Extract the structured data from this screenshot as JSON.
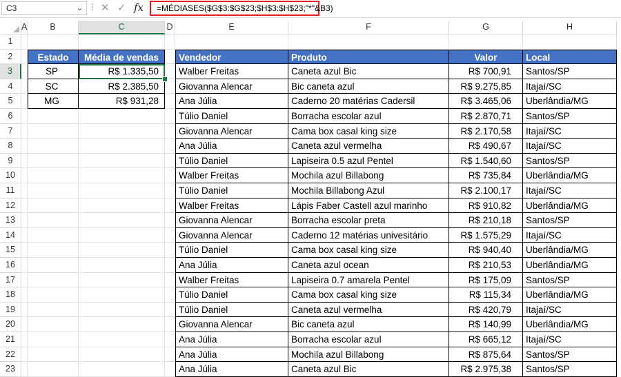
{
  "formula_bar": {
    "name_box": "C3",
    "formula": "=MÉDIASES($G$3:$G$23;$H$3:$H$23;\"*\"&B3)",
    "fx_label": "fx"
  },
  "columns": [
    "A",
    "B",
    "C",
    "D",
    "E",
    "F",
    "G",
    "H"
  ],
  "rows": [
    "1",
    "2",
    "3",
    "4",
    "5",
    "6",
    "7",
    "8",
    "9",
    "10",
    "11",
    "12",
    "13",
    "14",
    "15",
    "16",
    "17",
    "18",
    "19",
    "20",
    "21",
    "22",
    "23"
  ],
  "summary": {
    "headers": [
      "Estado",
      "Média de vendas"
    ],
    "rows": [
      [
        "SP",
        "R$ 1.335,50"
      ],
      [
        "SC",
        "R$ 2.385,50"
      ],
      [
        "MG",
        "R$ 931,28"
      ]
    ]
  },
  "sales": {
    "headers": [
      "Vendedor",
      "Produto",
      "Valor",
      "Local"
    ],
    "rows": [
      [
        "Walber Freitas",
        "Caneta azul Bic",
        "R$ 700,91",
        "Santos/SP"
      ],
      [
        "Giovanna Alencar",
        "Bic caneta azul",
        "R$ 9.275,85",
        "Itajaí/SC"
      ],
      [
        "Ana Júlia",
        "Caderno 20 matérias Cadersil",
        "R$ 3.465,06",
        "Uberlândia/MG"
      ],
      [
        "Túlio Daniel",
        "Borracha escolar azul",
        "R$ 2.870,71",
        "Santos/SP"
      ],
      [
        "Giovanna Alencar",
        "Cama box casal king size",
        "R$ 2.170,58",
        "Itajaí/SC"
      ],
      [
        "Ana Júlia",
        "Caneta azul vermelha",
        "R$ 490,67",
        "Itajaí/SC"
      ],
      [
        "Túlio Daniel",
        "Lapiseira 0.5 azul Pentel",
        "R$ 1.540,60",
        "Santos/SP"
      ],
      [
        "Walber Freitas",
        "Mochila azul Billabong",
        "R$ 735,84",
        "Uberlândia/MG"
      ],
      [
        "Túlio Daniel",
        "Mochila Billabong Azul",
        "R$ 2.100,17",
        "Itajaí/SC"
      ],
      [
        "Walber Freitas",
        "Lápis Faber Castell azul marinho",
        "R$ 910,82",
        "Uberlândia/MG"
      ],
      [
        "Giovanna Alencar",
        "Borracha escolar preta",
        "R$ 210,18",
        "Santos/SP"
      ],
      [
        "Giovanna Alencar",
        "Caderno 12 matérias univesitário",
        "R$ 1.575,29",
        "Itajaí/SC"
      ],
      [
        "Túlio Daniel",
        "Cama box casal king size",
        "R$ 940,40",
        "Uberlândia/MG"
      ],
      [
        "Ana Júlia",
        "Caneta azul ocean",
        "R$ 210,53",
        "Uberlândia/MG"
      ],
      [
        "Walber Freitas",
        "Lapiseira 0.7 amarela Pentel",
        "R$ 175,09",
        "Santos/SP"
      ],
      [
        "Túlio Daniel",
        "Cama box casal king size",
        "R$ 115,34",
        "Uberlândia/MG"
      ],
      [
        "Túlio Daniel",
        "Caneta azul vermelha",
        "R$ 420,79",
        "Itajaí/SC"
      ],
      [
        "Giovanna Alencar",
        "Bic caneta azul",
        "R$ 140,99",
        "Uberlândia/MG"
      ],
      [
        "Ana Júlia",
        "Borracha escolar azul",
        "R$ 665,12",
        "Itajaí/SC"
      ],
      [
        "Ana Júlia",
        "Mochila azul Billabong",
        "R$ 875,64",
        "Santos/SP"
      ],
      [
        "Ana Júlia",
        "Caneta azul Bic",
        "R$ 2.975,38",
        "Santos/SP"
      ]
    ]
  },
  "selection": {
    "column": "C",
    "row": "3"
  },
  "colors": {
    "header_blue": "#4472c4",
    "selection_green": "#217346",
    "formula_highlight": "#e51c23"
  }
}
